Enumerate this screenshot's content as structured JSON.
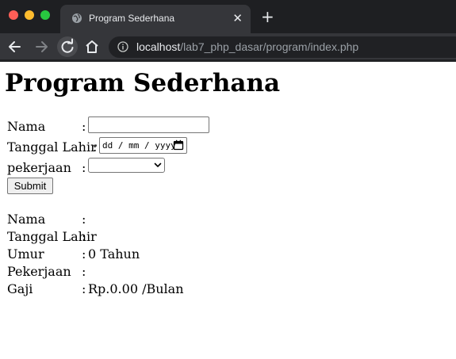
{
  "browser": {
    "tab_title": "Program Sederhana",
    "new_tab_symbol": "+",
    "tab_close_symbol": "✕",
    "url_host": "localhost",
    "url_path": "/lab7_php_dasar/program/index.php"
  },
  "page": {
    "heading": "Program Sederhana",
    "form": {
      "nama_label": "Nama",
      "tanggal_label": "Tanggal Lahir",
      "pekerjaan_label": "pekerjaan",
      "colon": ":",
      "nama_value": "",
      "tanggal_placeholder": "dd / mm / yyyy",
      "pekerjaan_selected": "",
      "submit_label": "Submit"
    },
    "result": {
      "colon": ":",
      "rows": [
        {
          "label": "Nama",
          "value": ""
        },
        {
          "label": "Tanggal Lahir",
          "value": ""
        },
        {
          "label": "Umur",
          "value": "0 Tahun"
        },
        {
          "label": "Pekerjaan",
          "value": ""
        },
        {
          "label": "Gaji",
          "value": "Rp.0.00 /Bulan"
        }
      ]
    }
  },
  "icons": {
    "back": "back-arrow-icon",
    "forward": "forward-arrow-icon",
    "reload": "reload-icon",
    "home": "home-icon",
    "info": "info-icon",
    "globe": "globe-icon",
    "calendar": "calendar-icon"
  },
  "colors": {
    "chrome_dark": "#1e1f22",
    "chrome_tab": "#35363a",
    "omnibox": "#202124",
    "traffic_red": "#fe5f57",
    "traffic_yellow": "#febc2e",
    "traffic_green": "#28c840"
  }
}
